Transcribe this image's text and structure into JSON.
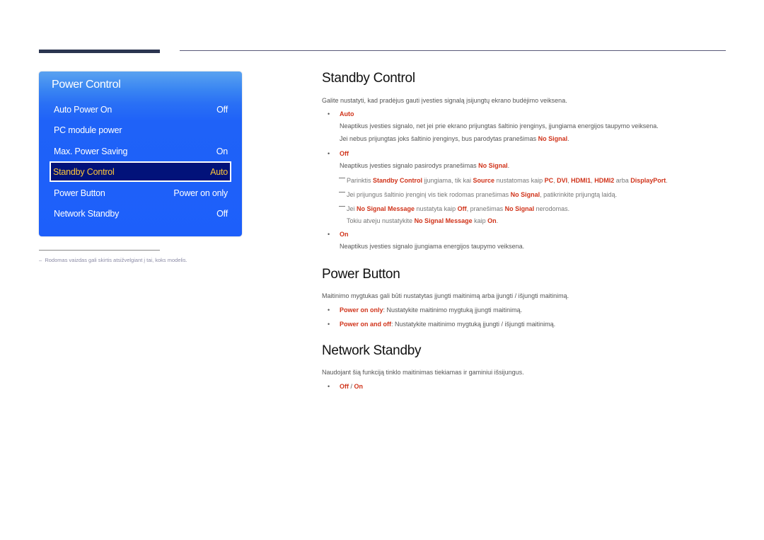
{
  "osd_menu": {
    "title": "Power Control",
    "items": [
      {
        "label": "Auto Power On",
        "value": "Off"
      },
      {
        "label": "PC module power",
        "value": ""
      },
      {
        "label": "Max. Power Saving",
        "value": "On"
      },
      {
        "label": "Standby Control",
        "value": "Auto",
        "selected": true
      },
      {
        "label": "Power Button",
        "value": "Power on only"
      },
      {
        "label": "Network Standby",
        "value": "Off"
      }
    ]
  },
  "footnote": "Rodomas vaizdas gali skirtis atsižvelgiant į tai, koks modelis.",
  "sections": {
    "standby": {
      "title": "Standby Control",
      "intro": "Galite nustatyti, kad pradėjus gauti įvesties signalą įsijungtų ekrano budėjimo veiksena.",
      "auto_label": "Auto",
      "auto_line1": "Neaptikus įvesties signalo, net jei prie ekrano prijungtas šaltinio įrenginys, įjungiama energijos taupymo veiksena.",
      "auto_line2_pre": "Jei nebus prijungtas joks šaltinio įrenginys, bus parodytas pranešimas ",
      "auto_line2_hl": "No Signal",
      "auto_line2_post": ".",
      "off_label": "Off",
      "off_line_pre": "Neaptikus įvesties signalo pasirodys pranešimas ",
      "off_line_hl": "No Signal",
      "off_line_post": ".",
      "note1": {
        "t1": "Parinktis ",
        "h1": "Standby Control",
        "t2": " įjungiama, tik kai ",
        "h2": "Source",
        "t3": " nustatomas kaip ",
        "h3": "PC",
        "t4": ", ",
        "h4": "DVI",
        "t5": ", ",
        "h5": "HDMI1",
        "t6": ", ",
        "h6": "HDMI2",
        "t7": " arba ",
        "h7": "DisplayPort",
        "t8": "."
      },
      "note2": {
        "t1": "Jei prijungus šaltinio įrenginį vis tiek rodomas pranešimas ",
        "h1": "No Signal",
        "t2": ", patikrinkite prijungtą laidą."
      },
      "note3": {
        "t1": "Jei ",
        "h1": "No Signal Message",
        "t2": " nustatyta kaip ",
        "h2": "Off",
        "t3": ", pranešimas ",
        "h3": "No Signal",
        "t4": " nerodomas.",
        "l2_t1": "Tokiu atveju nustatykite ",
        "l2_h1": "No Signal Message",
        "l2_t2": " kaip ",
        "l2_h2": "On",
        "l2_t3": "."
      },
      "on_label": "On",
      "on_line": "Neaptikus įvesties signalo įjungiama energijos taupymo veiksena."
    },
    "power_button": {
      "title": "Power Button",
      "intro": "Maitinimo mygtukas gali būti nustatytas įjungti maitinimą arba įjungti / išjungti maitinimą.",
      "opt1_label": "Power on only",
      "opt1_text": ": Nustatykite maitinimo mygtuką įjungti maitinimą.",
      "opt2_label": "Power on and off",
      "opt2_text": ": Nustatykite maitinimo mygtuką įjungti / išjungti maitinimą."
    },
    "network_standby": {
      "title": "Network Standby",
      "intro": "Naudojant šią funkciją tinklo maitinimas tiekiamas ir gaminiui išsijungus.",
      "opt_off": "Off",
      "opt_sep": " / ",
      "opt_on": "On"
    }
  }
}
